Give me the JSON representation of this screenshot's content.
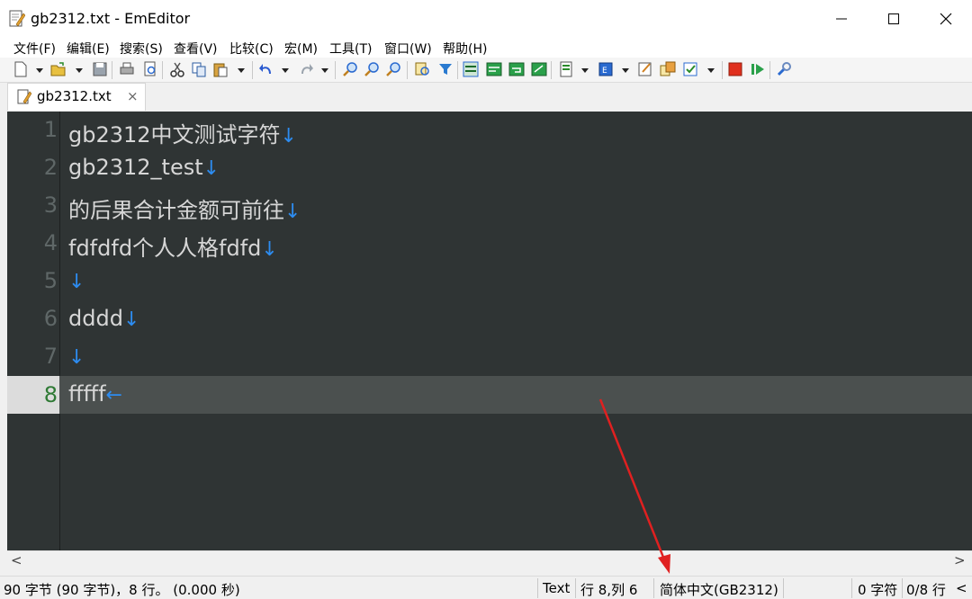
{
  "window": {
    "title": "gb2312.txt - EmEditor"
  },
  "menu": [
    "文件(F)",
    "编辑(E)",
    "搜索(S)",
    "查看(V)",
    "比较(C)",
    "宏(M)",
    "工具(T)",
    "窗口(W)",
    "帮助(H)"
  ],
  "tabs": [
    {
      "label": "gb2312.txt",
      "close": "×"
    }
  ],
  "editor": {
    "lines": [
      {
        "n": "1",
        "text": "gb2312中文测试字符",
        "eol": "↓"
      },
      {
        "n": "2",
        "text": "gb2312_test",
        "eol": "↓"
      },
      {
        "n": "3",
        "text": "的后果合计金额可前往",
        "eol": "↓"
      },
      {
        "n": "4",
        "text": "fdfdfd个人人格fdfd",
        "eol": "↓"
      },
      {
        "n": "5",
        "text": "",
        "eol": "↓"
      },
      {
        "n": "6",
        "text": "dddd",
        "eol": "↓"
      },
      {
        "n": "7",
        "text": "",
        "eol": "↓"
      },
      {
        "n": "8",
        "text": "fffff",
        "eol": "←"
      }
    ],
    "current_line": 8
  },
  "scroll": {
    "left": "<",
    "right": ">"
  },
  "status": {
    "info": "90 字节 (90 字节)，8 行。 (0.000 秒)",
    "mode": "Text",
    "position": "行 8,列 6",
    "encoding": "简体中文(GB2312)",
    "chars": "0 字符",
    "lines": "0/8 行",
    "overflow": "<"
  },
  "colors": {
    "editor_bg": "#2f3434",
    "current_line_bg": "#4b504f",
    "text": "#d6d6d6",
    "eol_marker": "#2d8cf0",
    "line_number": "#5f6767",
    "current_line_number": "#2f7a35",
    "annotation_arrow": "#e02020"
  }
}
